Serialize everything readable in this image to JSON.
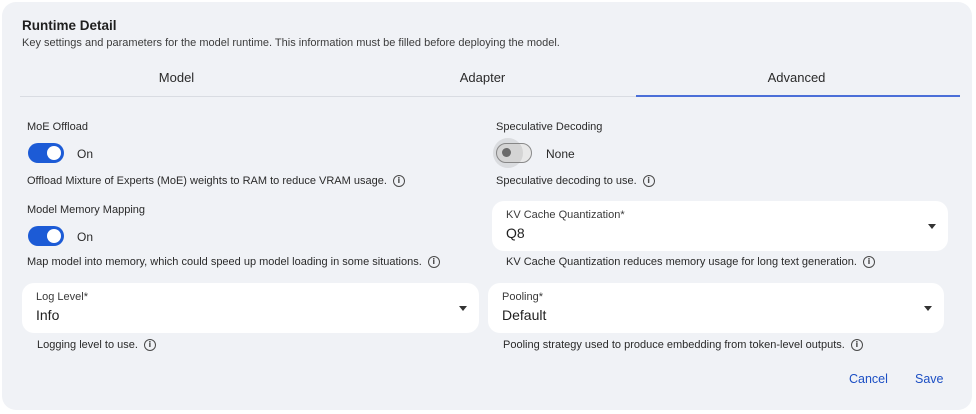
{
  "header": {
    "title": "Runtime Detail",
    "subtitle": "Key settings and parameters for the model runtime. This information must be filled before deploying the model."
  },
  "tabs": [
    {
      "label": "Model",
      "active": false
    },
    {
      "label": "Adapter",
      "active": false
    },
    {
      "label": "Advanced",
      "active": true
    }
  ],
  "moe_offload": {
    "label": "MoE Offload",
    "state": "On",
    "enabled": true,
    "help": "Offload Mixture of Experts (MoE) weights to RAM to reduce VRAM usage."
  },
  "speculative_decoding": {
    "label": "Speculative Decoding",
    "state": "None",
    "enabled": false,
    "help": "Speculative decoding to use."
  },
  "memory_mapping": {
    "label": "Model Memory Mapping",
    "state": "On",
    "enabled": true,
    "help": "Map model into memory, which could speed up model loading in some situations."
  },
  "kv_cache": {
    "label": "KV Cache Quantization*",
    "value": "Q8",
    "help": "KV Cache Quantization reduces memory usage for long text generation."
  },
  "log_level": {
    "label": "Log Level*",
    "value": "Info",
    "help": "Logging level to use."
  },
  "pooling": {
    "label": "Pooling*",
    "value": "Default",
    "help": "Pooling strategy used to produce embedding from token-level outputs."
  },
  "actions": {
    "cancel": "Cancel",
    "save": "Save"
  },
  "colors": {
    "accent": "#1c5bd6",
    "panel_bg": "#f0f2f6",
    "link": "#1c4fc4"
  }
}
